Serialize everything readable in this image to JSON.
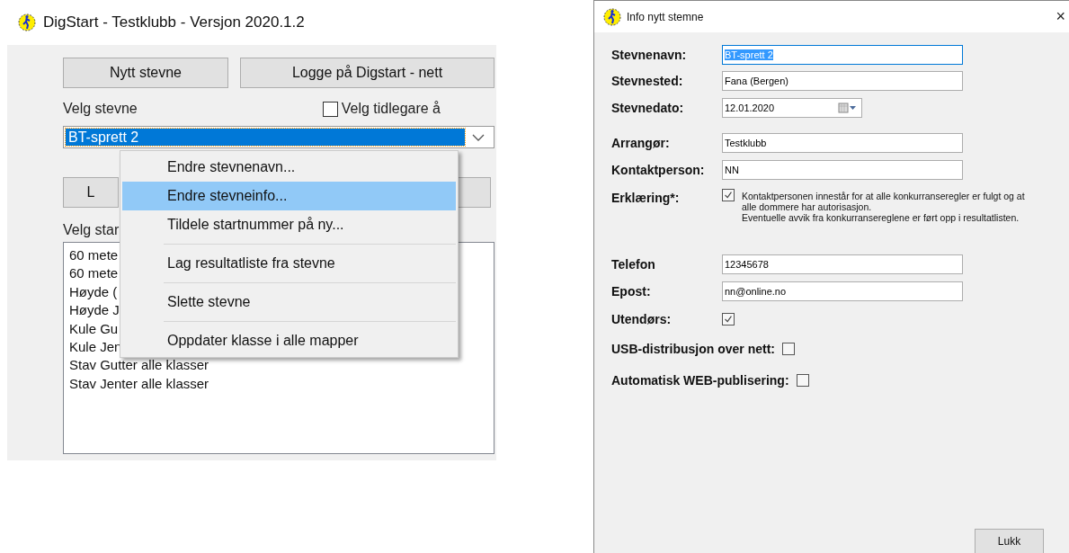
{
  "main_window": {
    "title": "DigStart - Testklubb - Versjon 2020.1.2",
    "top_buttons": [
      "Nytt stevne",
      "Logge på Digstart - nett"
    ],
    "event_label": "Velg stevne",
    "earlier_checkbox": {
      "label": "Velg tidlegare å",
      "checked": false
    },
    "event_select": {
      "value": "BT-sprett 2",
      "selected": true
    },
    "partial_button": "L",
    "start_list_label": "Velg star",
    "start_list": [
      "60 mete",
      "60 mete",
      "Høyde (",
      "Høyde J",
      "Kule Gu",
      "Kule Jen",
      "Stav Gutter alle klasser",
      "Stav Jenter alle klasser"
    ]
  },
  "context_menu": {
    "items": [
      {
        "label": "Endre stevnenavn...",
        "selected": false,
        "separator_after": false
      },
      {
        "label": "Endre stevneinfo...",
        "selected": true,
        "separator_after": false
      },
      {
        "label": "Tildele startnummer på ny...",
        "selected": false,
        "separator_after": true
      },
      {
        "label": "Lag resultatliste fra stevne",
        "selected": false,
        "separator_after": true
      },
      {
        "label": "Slette stevne",
        "selected": false,
        "separator_after": true
      },
      {
        "label": "Oppdater klasse i alle mapper",
        "selected": false,
        "separator_after": false
      }
    ]
  },
  "dialog": {
    "title": "Info nytt stemne",
    "close": "×",
    "fields": [
      {
        "kind": "text",
        "label": "Stevnenavn:",
        "value": "BT-sprett 2",
        "selected": true
      },
      {
        "kind": "text",
        "label": "Stevnested:",
        "value": "Fana (Bergen)",
        "selected": false
      },
      {
        "kind": "date",
        "label": "Stevnedato:",
        "value": "12.01.2020"
      },
      {
        "kind": "gap"
      },
      {
        "kind": "text",
        "label": "Arrangør:",
        "value": "Testklubb",
        "selected": false
      },
      {
        "kind": "text",
        "label": "Kontaktperson:",
        "value": "NN",
        "selected": false
      },
      {
        "kind": "declaration",
        "label": "Erklæring*:",
        "checked": true,
        "lines": [
          "Kontaktpersonen innestår for at alle konkurranseregler er fulgt og at",
          "alle dommere har autorisasjon.",
          "Eventuelle avvik fra konkurransereglene er ført opp i resultatlisten."
        ]
      },
      {
        "kind": "gap"
      },
      {
        "kind": "text",
        "label": "Telefon",
        "value": "12345678",
        "selected": false
      },
      {
        "kind": "text",
        "label": "Epost:",
        "value": "nn@online.no",
        "selected": false
      },
      {
        "kind": "check",
        "label": "Utendørs:",
        "checked": true
      },
      {
        "kind": "inline_check",
        "label": "USB-distribusjon over nett:",
        "checked": false
      },
      {
        "kind": "inline_check",
        "label": "Automatisk WEB-publisering:",
        "checked": false
      }
    ],
    "button": "Lukk"
  }
}
